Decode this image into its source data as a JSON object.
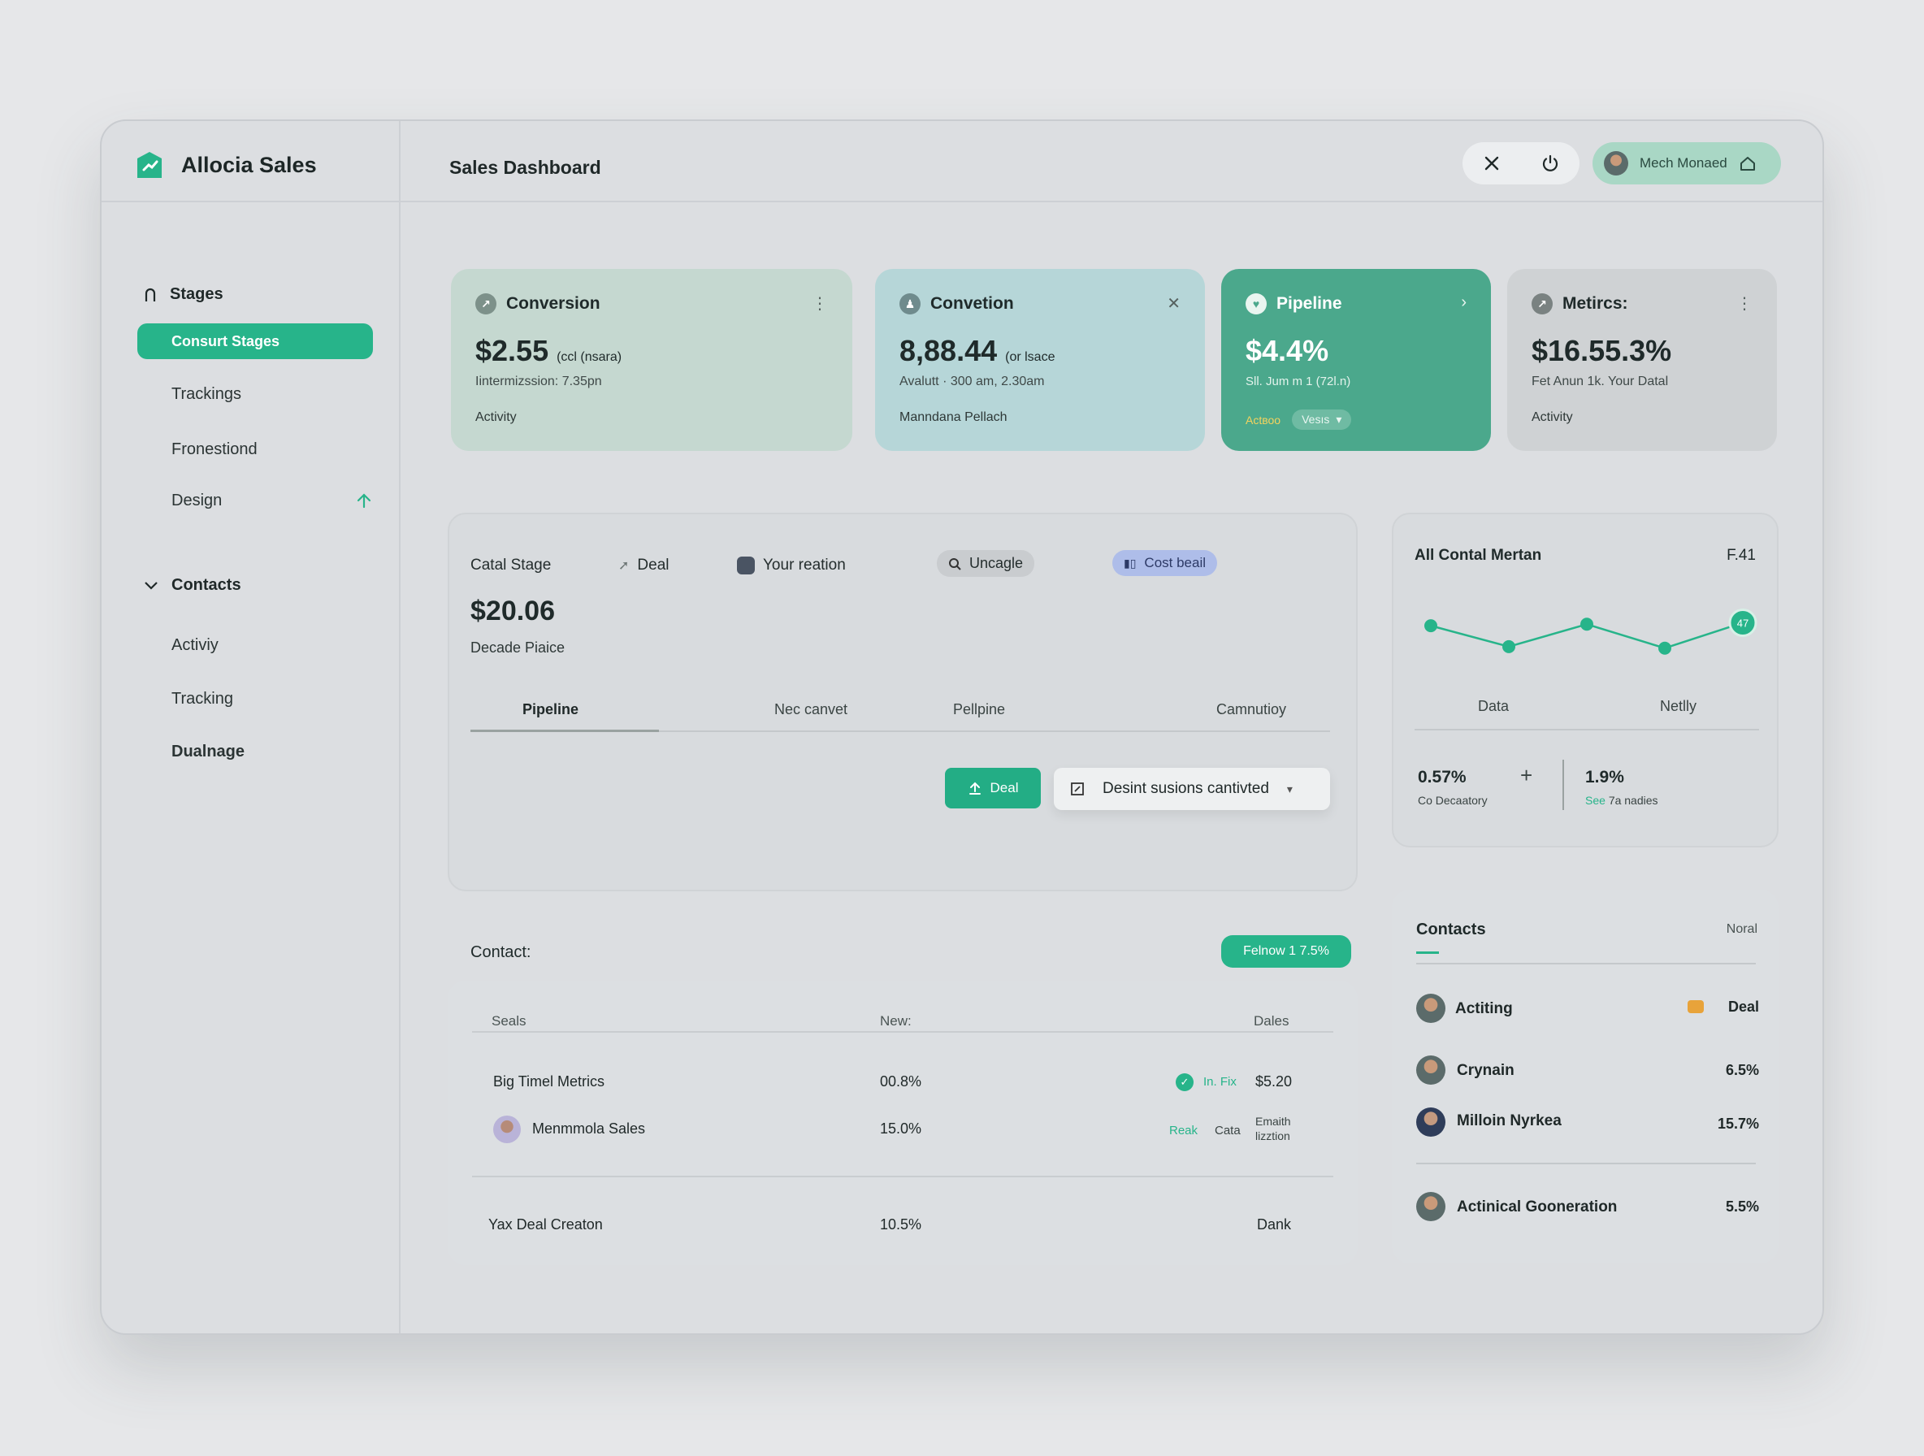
{
  "app": {
    "name": "Allocia Sales",
    "page_title": "Sales Dashboard"
  },
  "user": {
    "name": "Mech Monaed"
  },
  "sidebar": {
    "stages_heading": "Stages",
    "stages_items": [
      "Consurt Stages",
      "Trackings",
      "Fronestiond",
      "Design"
    ],
    "contacts_heading": "Contacts",
    "contacts_items": [
      "Activiy",
      "Tracking",
      "Dualnage"
    ]
  },
  "cards": [
    {
      "title": "Conversion",
      "value": "$2.55",
      "value_note": "(ccl (nsara)",
      "sub": "Iintermizssion: 7.35pn",
      "foot": "Activity",
      "bg": "#c5d8d0"
    },
    {
      "title": "Convetion",
      "value": "8,88.44",
      "value_note": "(or lsace",
      "sub": "Avalutt · 300 am, 2.30am",
      "foot": "Manndana Pellach",
      "bg": "#b6d6d8"
    },
    {
      "title": "Pipeline",
      "value": "$4.4%",
      "value_note": "",
      "sub": "Sll. Jum m 1 (72l.n)",
      "foot": "Actвоо",
      "foot_chip": "Vesıs",
      "bg": "#4ba88c"
    },
    {
      "title": "Metircs:",
      "value": "$16.55.3%",
      "value_note": "",
      "sub": "Fet Anun 1k. Your Datal",
      "foot": "Activity",
      "bg": "#cfd2d4"
    }
  ],
  "stage_panel": {
    "label": "Catal Stage",
    "filters": [
      "Deal",
      "Your reation",
      "Uncagle",
      "Cost beail"
    ],
    "amount": "$20.06",
    "amount_caption": "Decade Piaice",
    "tabs": [
      "Pipeline",
      "Nec canvet",
      "Pellpine",
      "Camnutioy"
    ],
    "deal_button": "Deal",
    "dropdown_label": "Desint susions cantivted"
  },
  "metric_panel": {
    "title": "All Contal Mertan",
    "badge": "F.41",
    "x_labels": [
      "Data",
      "Netlly"
    ],
    "stat1_value": "0.57%",
    "stat1_caption": "Co Decaatory",
    "stat2_value": "1.9%",
    "stat2_caption_a": "Sеe",
    "stat2_caption_b": "7a nadies",
    "last_point_label": "47",
    "chart_data": {
      "type": "line",
      "values": [
        0.64,
        0.36,
        0.66,
        0.34,
        0.68
      ],
      "ylim": [
        0,
        1
      ]
    }
  },
  "contact_section": {
    "label": "Contact:",
    "badge": "Felnow 1 7.5%"
  },
  "table": {
    "headers": [
      "Seals",
      "New:",
      "Dales"
    ],
    "rows": [
      {
        "name": "Big Timel Metrics",
        "new": "00.8%",
        "tag": "In. Fix",
        "dales": "$5.20"
      },
      {
        "name": "Menmmola Sales",
        "new": "15.0%",
        "tag1": "Reak",
        "tag2": "Cata",
        "dales": "Emaith lizztion"
      },
      {
        "name": "Yax  Deal Creaton",
        "new": "10.5%",
        "dales": "Dank"
      }
    ]
  },
  "contacts_list": {
    "title": "Contacts",
    "right_label": "Noral",
    "items": [
      {
        "name": "Actiting",
        "value": "Deal"
      },
      {
        "name": "Crynain",
        "value": "6.5%"
      },
      {
        "name": "Milloin Nyrkea",
        "value": "15.7%"
      },
      {
        "name": "Actinical Gooneration",
        "value": "5.5%"
      }
    ]
  },
  "colors": {
    "accent": "#27b48a",
    "chip_blue": "#aebde9"
  }
}
